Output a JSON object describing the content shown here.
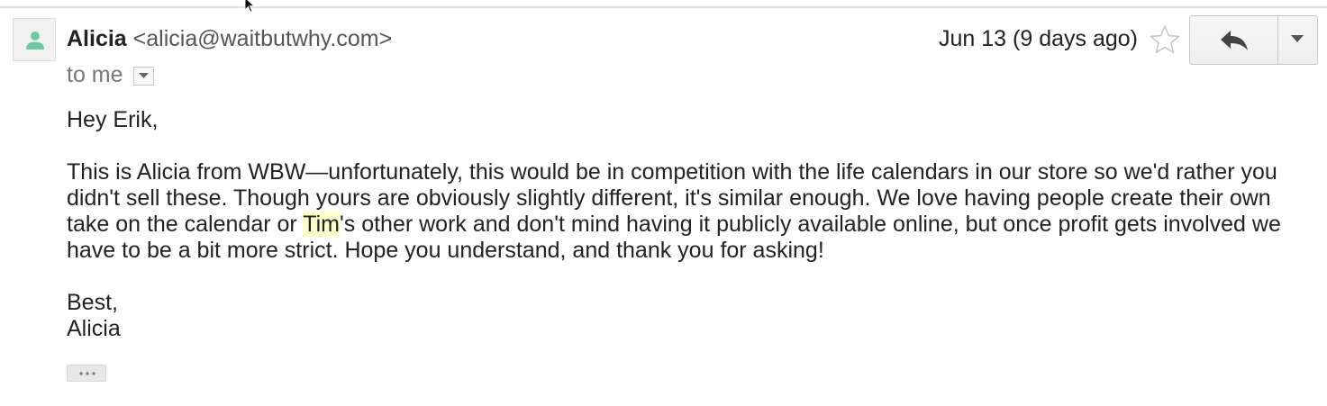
{
  "message": {
    "sender_name": "Alicia",
    "sender_email": "<alicia@waitbutwhy.com>",
    "recipient_line": "to me",
    "date": "Jun 13 (9 days ago)",
    "starred": false
  },
  "body": {
    "greeting": "Hey Erik,",
    "para_before_highlight": "This is Alicia from WBW—unfortunately, this would be in competition with the life calendars in our store so we'd rather you didn't sell these. Though yours are obviously slightly different, it's similar enough. We love having people create their own take on the calendar or ",
    "highlight": "Tim",
    "para_after_highlight": "'s other work and don't mind having it publicly available online, but once profit gets involved we have to be a bit more strict. Hope you understand, and thank you for asking!",
    "signoff": "Best,",
    "signature": "Alicia"
  },
  "icons": {
    "avatar": "person-icon",
    "details": "chevron-down-icon",
    "star": "star-outline-icon",
    "reply": "reply-arrow-icon",
    "more": "caret-down-icon",
    "trimmed": "ellipsis-icon"
  },
  "colors": {
    "avatar_person": "#6fc8a4",
    "highlight_bg": "#ffffcc",
    "email_gray": "#555555",
    "to_gray": "#777777"
  }
}
